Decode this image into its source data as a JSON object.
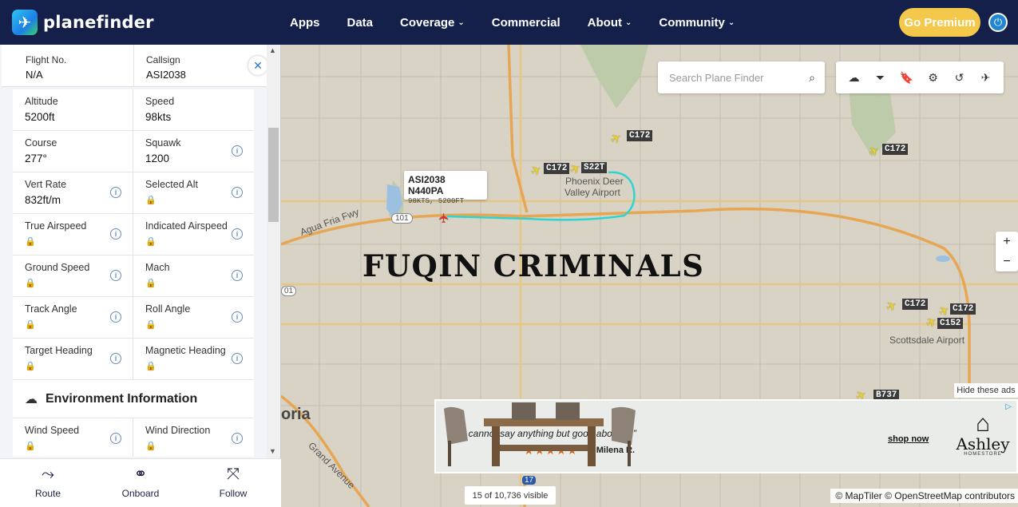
{
  "header": {
    "brand": "planefinder",
    "nav": [
      {
        "label": "Apps",
        "has_menu": false
      },
      {
        "label": "Data",
        "has_menu": false
      },
      {
        "label": "Coverage",
        "has_menu": true
      },
      {
        "label": "Commercial",
        "has_menu": false
      },
      {
        "label": "About",
        "has_menu": true
      },
      {
        "label": "Community",
        "has_menu": true
      }
    ],
    "premium_label": "Go Premium",
    "power_icon": "power-icon"
  },
  "flight": {
    "flight_no_label": "Flight No.",
    "flight_no": "N/A",
    "callsign_label": "Callsign",
    "callsign": "ASI2038",
    "rows": [
      {
        "left": {
          "label": "Altitude",
          "value": "5200ft",
          "info": false,
          "locked": false
        },
        "right": {
          "label": "Speed",
          "value": "98kts",
          "info": false,
          "locked": false
        }
      },
      {
        "left": {
          "label": "Course",
          "value": "277°",
          "info": false,
          "locked": false
        },
        "right": {
          "label": "Squawk",
          "value": "1200",
          "info": true,
          "locked": false
        }
      },
      {
        "left": {
          "label": "Vert Rate",
          "value": "832ft/m",
          "info": true,
          "locked": false
        },
        "right": {
          "label": "Selected Alt",
          "value": "",
          "info": true,
          "locked": true
        }
      },
      {
        "left": {
          "label": "True Airspeed",
          "value": "",
          "info": true,
          "locked": true
        },
        "right": {
          "label": "Indicated Airspeed",
          "value": "",
          "info": true,
          "locked": true
        }
      },
      {
        "left": {
          "label": "Ground Speed",
          "value": "",
          "info": true,
          "locked": true
        },
        "right": {
          "label": "Mach",
          "value": "",
          "info": true,
          "locked": true
        }
      },
      {
        "left": {
          "label": "Track Angle",
          "value": "",
          "info": true,
          "locked": true
        },
        "right": {
          "label": "Roll Angle",
          "value": "",
          "info": true,
          "locked": true
        }
      },
      {
        "left": {
          "label": "Target Heading",
          "value": "",
          "info": true,
          "locked": true
        },
        "right": {
          "label": "Magnetic Heading",
          "value": "",
          "info": true,
          "locked": true
        }
      }
    ],
    "env_title": "Environment Information",
    "env_rows": [
      {
        "left": {
          "label": "Wind Speed",
          "value": "",
          "info": true,
          "locked": true
        },
        "right": {
          "label": "Wind Direction",
          "value": "",
          "info": true,
          "locked": true
        }
      }
    ]
  },
  "bottom_bar": [
    {
      "label": "Route",
      "icon": "route-icon"
    },
    {
      "label": "Onboard",
      "icon": "binoculars-icon"
    },
    {
      "label": "Follow",
      "icon": "follow-icon"
    }
  ],
  "map": {
    "search_placeholder": "Search Plane Finder",
    "tools": [
      "weather-icon",
      "filter-icon",
      "bookmark-icon",
      "settings-icon",
      "history-icon",
      "aircraft-settings-icon"
    ],
    "tooltip_title": "ASI2038 N440PA",
    "tooltip_sub": "98KTS, 5200FT",
    "overlay_text": "FUQIN CRIMINALS",
    "aircraft_labels": [
      "C172",
      "C172",
      "S22T",
      "C172",
      "C172",
      "C172",
      "C152",
      "B737"
    ],
    "place_labels": {
      "airport1_a": "Phoenix Deer",
      "airport1_b": "Valley Airport",
      "airport2": "Scottsdale Airport",
      "road1": "Agua Fria Fwy",
      "road2": "Grand Avenue",
      "shield1": "101",
      "shield2": "01",
      "shield3": "17",
      "city": "oria"
    },
    "visible_count": "15 of 10,736 visible",
    "attribution": "© MapTiler © OpenStreetMap contributors",
    "hide_ads": "Hide these ads",
    "ad": {
      "quote": "I cannot say anything but good about it!!",
      "stars": "★★★★★",
      "author": "- Milena R.",
      "shop": "shop now",
      "brand": "Ashley",
      "brand_sub": "HOMESTORE"
    }
  }
}
